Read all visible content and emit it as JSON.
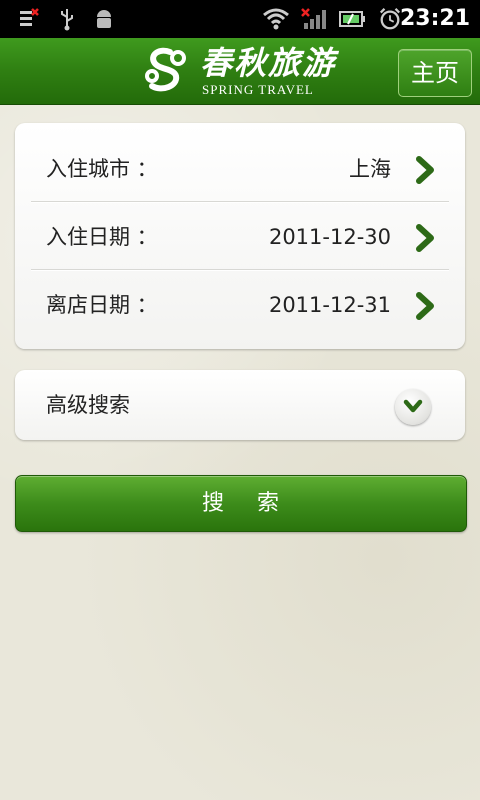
{
  "status_bar": {
    "time": "23:21",
    "icons": [
      "notification-icon",
      "usb-icon",
      "android-debug-icon",
      "wifi-icon",
      "signal-icon",
      "battery-icon",
      "alarm-icon"
    ]
  },
  "header": {
    "logo_cn": "春秋旅游",
    "logo_en": "SPRING TRAVEL",
    "home_label": "主页",
    "colors": {
      "header_green": "#2f7f12"
    }
  },
  "form": {
    "rows": [
      {
        "label": "入住城市 ：",
        "value": "上海"
      },
      {
        "label": "入住日期 ：",
        "value": "2011-12-30"
      },
      {
        "label": "离店日期 ：",
        "value": "2011-12-31"
      }
    ]
  },
  "advanced": {
    "label": "高级搜索"
  },
  "search": {
    "label": "搜    索"
  }
}
